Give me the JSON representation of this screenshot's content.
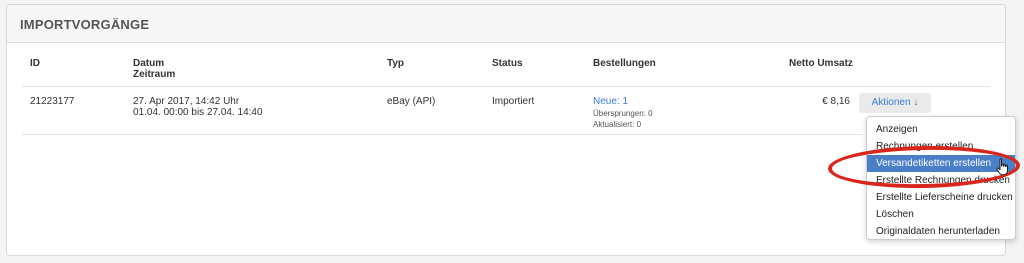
{
  "panel": {
    "title": "IMPORTVORGÄNGE"
  },
  "table": {
    "headers": {
      "id": "ID",
      "datum": "Datum",
      "zeitraum": "Zeitraum",
      "typ": "Typ",
      "status": "Status",
      "bestellungen": "Bestellungen",
      "netto": "Netto Umsatz"
    },
    "rows": [
      {
        "id": "21223177",
        "datum": "27. Apr 2017, 14:42 Uhr",
        "zeitraum": "01.04. 00:00 bis 27.04. 14:40",
        "typ": "eBay (API)",
        "status": "Importiert",
        "neue": "Neue: 1",
        "uebersprungen": "Übersprungen: 0",
        "aktualisiert": "Aktualisiert: 0",
        "netto": "€ 8,16"
      }
    ]
  },
  "actions": {
    "button_label": "Aktionen ↓",
    "menu": [
      "Anzeigen",
      "Rechnungen erstellen",
      "Versandetiketten erstellen",
      "Erstellte Rechnungen drucken",
      "Erstellte Lieferscheine drucken",
      "Löschen",
      "Originaldaten herunterladen"
    ],
    "active_index": 2
  },
  "colors": {
    "link": "#3a7bd5",
    "highlight": "#4a7fc7",
    "annotation": "#d9261c"
  },
  "icons": {
    "cursor": "hand-pointer-icon"
  }
}
